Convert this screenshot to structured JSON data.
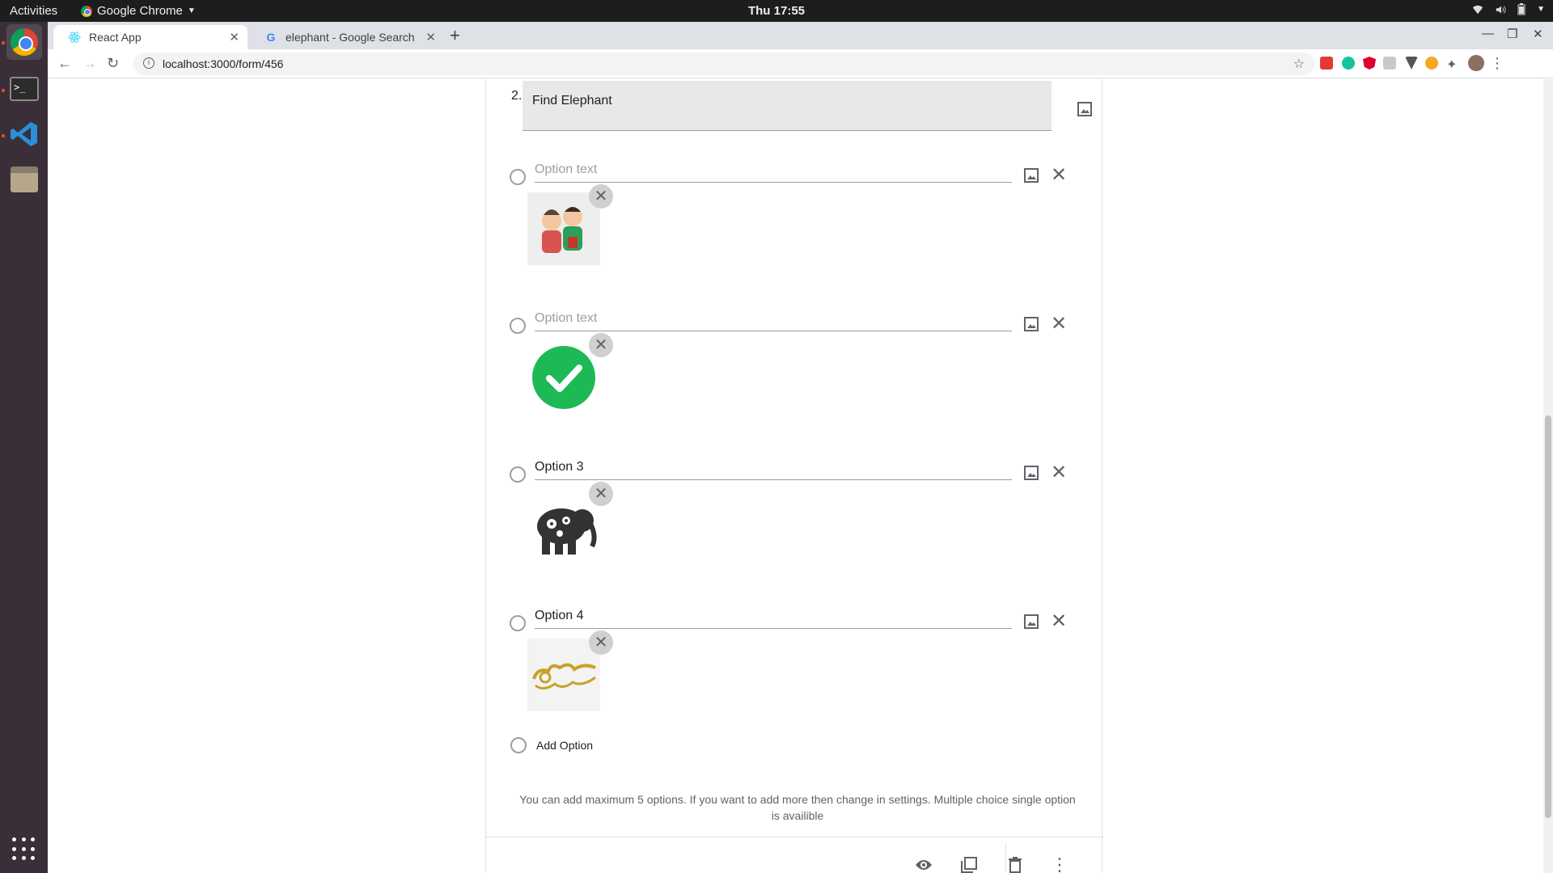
{
  "system": {
    "activities": "Activities",
    "app_name": "Google Chrome",
    "clock": "Thu 17:55"
  },
  "browser": {
    "tabs": [
      {
        "title": "React App"
      },
      {
        "title": "elephant - Google Search"
      }
    ],
    "url": "localhost:3000/form/456"
  },
  "question": {
    "number": "2.",
    "title": "Find Elephant"
  },
  "options": [
    {
      "text": "",
      "placeholder": "Option text",
      "image": "thai-couple-cartoon"
    },
    {
      "text": "",
      "placeholder": "Option text",
      "image": "green-checkmark"
    },
    {
      "text": "Option 3",
      "placeholder": "Option text",
      "image": "decorated-elephant-drawing"
    },
    {
      "text": "Option 4",
      "placeholder": "Option text",
      "image": "gold-thai-ornament"
    }
  ],
  "add_option_label": "Add Option",
  "note": "You can add maximum 5 options. If you want to add more then change in settings. Multiple choice single option is availible",
  "colors": {
    "check_green": "#1db954",
    "ornament_gold": "#c9a227"
  }
}
